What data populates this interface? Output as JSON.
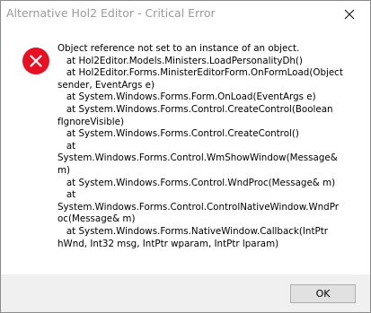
{
  "window": {
    "title": "Alternative Hol2 Editor - Critical Error"
  },
  "titlebar": {
    "close_icon": "close-icon"
  },
  "dialog": {
    "icon": "error-icon",
    "message_lines": [
      "Object reference not set to an instance of an object.",
      "   at Hol2Editor.Models.Ministers.LoadPersonalityDh()",
      "   at Hol2Editor.Forms.MinisterEditorForm.OnFormLoad(Object",
      "sender, EventArgs e)",
      "   at System.Windows.Forms.Form.OnLoad(EventArgs e)",
      "   at System.Windows.Forms.Control.CreateControl(Boolean",
      "fIgnoreVisible)",
      "   at System.Windows.Forms.Control.CreateControl()",
      "   at",
      "System.Windows.Forms.Control.WmShowWindow(Message&",
      "m)",
      "   at System.Windows.Forms.Control.WndProc(Message& m)",
      "   at",
      "System.Windows.Forms.Control.ControlNativeWindow.WndPr",
      "oc(Message& m)",
      "   at System.Windows.Forms.NativeWindow.Callback(IntPtr",
      "hWnd, Int32 msg, IntPtr wparam, IntPtr lparam)"
    ]
  },
  "footer": {
    "ok_label": "OK"
  },
  "colors": {
    "error_red": "#e81123",
    "footer_bg": "#f0f0f0",
    "button_bg": "#e1e1e1"
  }
}
